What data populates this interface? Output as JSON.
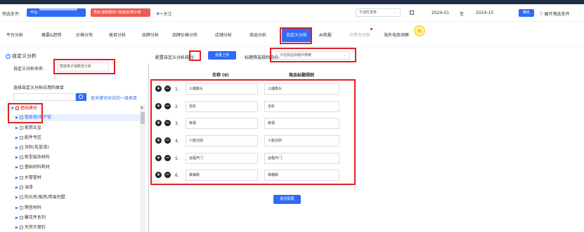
{
  "filter": {
    "label": "筛选条件:",
    "platform_chip": "平台:",
    "category_chip": "类目:基础建材>智能锁/电子锁",
    "add_follow": "+关注",
    "exp_select": "不减优惠券",
    "date_from": "2024-01",
    "date_to_label": "至",
    "date_to": "2024-10",
    "confirm": "确定",
    "expand": "展开筛选条件"
  },
  "tabs": [
    {
      "label": "平台分析"
    },
    {
      "label": "概要&趋势"
    },
    {
      "label": "价格分布"
    },
    {
      "label": "类目分析"
    },
    {
      "label": "品牌分析"
    },
    {
      "label": "品牌价格分布"
    },
    {
      "label": "店铺分析"
    },
    {
      "label": "商品分析"
    },
    {
      "label": "自定义分析"
    },
    {
      "label": "AI简报"
    },
    {
      "label": "消费者洞察"
    },
    {
      "label": "海外电商洞察"
    }
  ],
  "panel": {
    "title": "自定义分析",
    "name_label": "自定义分析命名:",
    "name_value": "智能电子锁概念分析",
    "scope_label": "选择自定义分析应用的类目",
    "search_placeholder": "",
    "search_hint": "查关键词对应的一级类目"
  },
  "tree": [
    {
      "label": "基础建材"
    },
    {
      "label": "智能锁/电子锁"
    },
    {
      "label": "家用五金"
    },
    {
      "label": "配件专区"
    },
    {
      "label": "涂料(乳胶漆)"
    },
    {
      "label": "新型装饰材料"
    },
    {
      "label": "基础材料耗材"
    },
    {
      "label": "水管管材"
    },
    {
      "label": "油漆"
    },
    {
      "label": "阳光房/板房/简易别墅"
    },
    {
      "label": "隔音材料"
    },
    {
      "label": "雕花件系列"
    },
    {
      "label": "天然大理石"
    }
  ],
  "config": {
    "label": "配置自定义分析规则:",
    "bulk_upload": "批量上传",
    "filter_rule_label": "标题筛选规则选择:",
    "rule_select": "只在商品标题中搜索",
    "col_name": "名称 (6)",
    "col_rule": "商品标题规则",
    "rows": [
      {
        "num": "1.",
        "name": "三摄像头",
        "rule": "三摄像头"
      },
      {
        "num": "2.",
        "name": "全彩",
        "rule": "全彩"
      },
      {
        "num": "3.",
        "name": "夜视",
        "rule": "夜视"
      },
      {
        "num": "4.",
        "name": "人脸识别",
        "rule": "人脸识别"
      },
      {
        "num": "5.",
        "name": "远程开门",
        "rule": "远程开门"
      },
      {
        "num": "6.",
        "name": "掌静脉",
        "rule": "掌静脉"
      }
    ],
    "submit": "提交配置"
  }
}
